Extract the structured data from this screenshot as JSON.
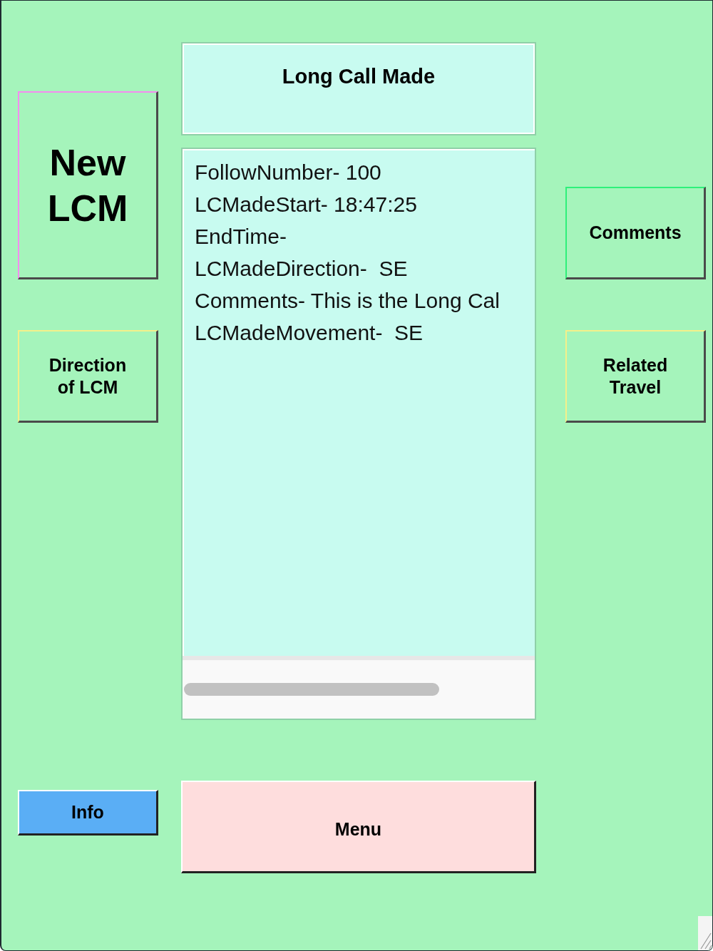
{
  "title_panel": {
    "title": "Long Call Made"
  },
  "record": {
    "lines": [
      "FollowNumber- 100",
      "LCMadeStart- 18:47:25",
      "EndTime-",
      "LCMadeDirection-  SE",
      "Comments- This is the Long Cal",
      "LCMadeMovement-  SE"
    ]
  },
  "left_buttons": [
    {
      "kind": "large",
      "label": "New LCM"
    },
    {
      "kind": "normal",
      "label": "Direction of LCM"
    }
  ],
  "right_buttons": [
    {
      "kind": "normal",
      "label": "Comments"
    },
    {
      "kind": "normal",
      "label": "Related Travel"
    }
  ],
  "info_button": {
    "label": "Info"
  },
  "menu_button": {
    "label": "Menu"
  }
}
